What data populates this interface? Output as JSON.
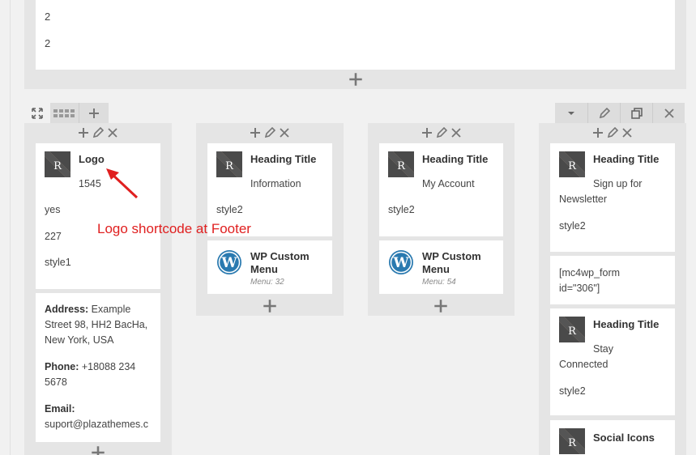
{
  "top_row": {
    "values": [
      "2",
      "2"
    ]
  },
  "row_toolbar": {
    "left": [
      "expand-icon",
      "columns-layout-icon",
      "add-column-icon"
    ],
    "right": [
      "chevron-down-icon",
      "pencil-icon",
      "duplicate-icon",
      "close-icon"
    ]
  },
  "columns": [
    {
      "cards": [
        {
          "title": "Logo",
          "lines": [
            "1545",
            "yes",
            "227",
            "style1"
          ]
        },
        {
          "address_label": "Address:",
          "address": "Example Street 98, HH2 BacHa, New York, USA",
          "phone_label": "Phone:",
          "phone": "+18088 234 5678",
          "email_label": "Email:",
          "email": "suport@plazathemes.c"
        }
      ]
    },
    {
      "cards": [
        {
          "title": "Heading Title",
          "lines": [
            "Information",
            "style2"
          ]
        },
        {
          "title": "WP Custom Menu",
          "meta": "Menu: 32"
        }
      ]
    },
    {
      "cards": [
        {
          "title": "Heading Title",
          "lines": [
            "My Account",
            "style2"
          ]
        },
        {
          "title": "WP Custom Menu",
          "meta": "Menu: 54"
        }
      ]
    },
    {
      "cards": [
        {
          "title": "Heading Title",
          "lines": [
            "Sign up for",
            "Newsletter",
            "style2"
          ]
        },
        {
          "lines": [
            "[mc4wp_form",
            "id=\"306\"]"
          ]
        },
        {
          "title": "Heading Title",
          "lines": [
            "Stay",
            "Connected",
            "style2"
          ]
        },
        {
          "title": "Social Icons"
        }
      ]
    }
  ],
  "annotation": "Logo shortcode at Footer",
  "colors": {
    "annotation": "#e02020",
    "wp_blue": "#2a7ab0",
    "thumb_dark": "#4a4a4a",
    "thumb_tan": "#c9ad94"
  }
}
